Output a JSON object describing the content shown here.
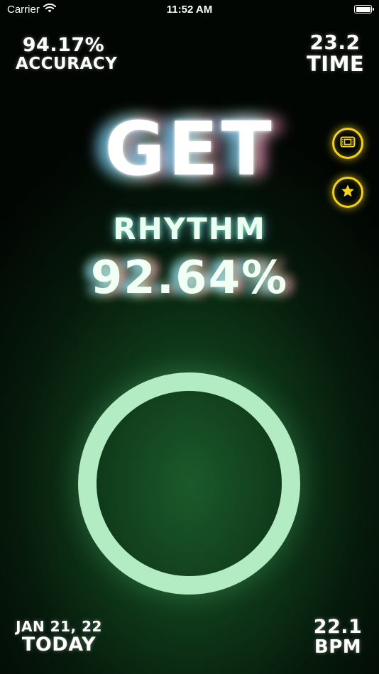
{
  "status_bar": {
    "carrier": "Carrier",
    "time": "11:52 AM"
  },
  "stats": {
    "accuracy": {
      "value": "94.17%",
      "label": "ACCURACY"
    },
    "time": {
      "value": "23.2",
      "label": "TIME"
    },
    "today": {
      "value": "JAN 21, 22",
      "label": "TODAY"
    },
    "bpm": {
      "value": "22.1",
      "label": "BPM"
    }
  },
  "main": {
    "headline": "GET",
    "subtitle": "RHYTHM",
    "score": "92.64%"
  },
  "icons": {
    "film": "film-ticket-icon",
    "star": "star-icon",
    "wifi": "wifi-icon",
    "battery": "battery-icon"
  },
  "colors": {
    "accent_yellow": "#f2d21b",
    "ring_green": "#b3ecc2",
    "background_green": "#1b5a2a"
  }
}
